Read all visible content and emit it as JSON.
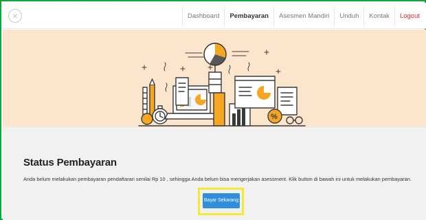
{
  "nav": {
    "items": [
      "Dashboard",
      "Pembayaran",
      "Asesmen Mandiri",
      "Unduh",
      "Kontak",
      "Logout"
    ],
    "active": "Pembayaran"
  },
  "hero": {
    "illustration": "finance-analytics-illustration",
    "currency_badge": "$",
    "percent_badge": "%"
  },
  "main": {
    "title": "Status Pembayaran",
    "message": "Anda belum melakukan pembayaran pendaftaran senilai Rp 10 , sehingga Anda belum bisa mengerjakan asessment. Klik button di bawah ini untuk melakukan pembayaran.",
    "pay_button_label": "Bayar Sekarang"
  },
  "colors": {
    "frame_border": "#12a43c",
    "hero_background": "#fbe5cc",
    "content_background": "#f1f1f1",
    "logout": "#e0262b",
    "button": "#2f8fdc",
    "highlight": "#f3ea34",
    "illustration_orange": "#f5a623"
  }
}
